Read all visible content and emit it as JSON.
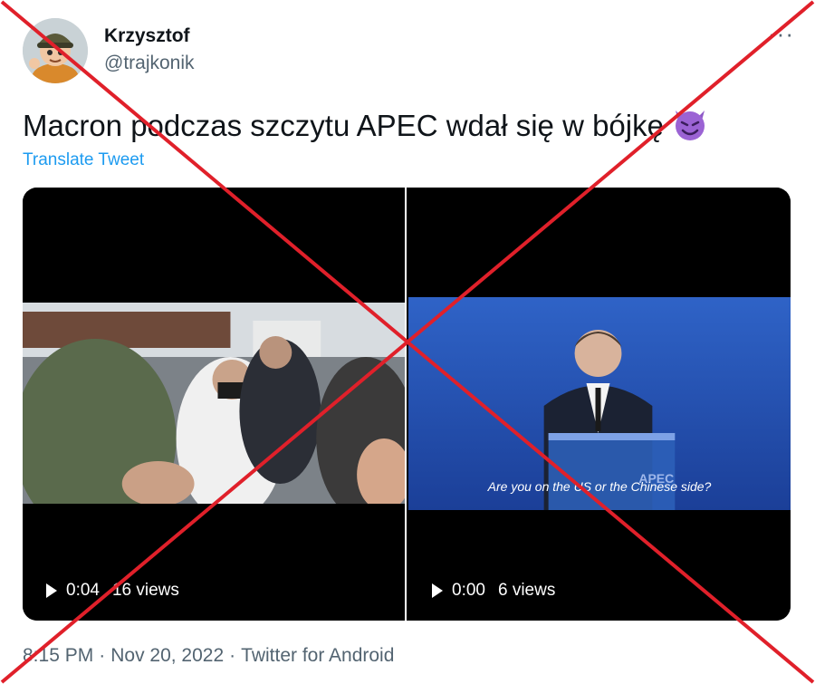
{
  "author": {
    "display_name": "Krzysztof",
    "handle": "@trajkonik",
    "avatar_icon": "cartoon-avatar"
  },
  "more_icon": "more-options-icon",
  "tweet": {
    "text": "Macron podczas szczytu APEC wdał się w bójkę",
    "emoji": "smiling-face-with-horns",
    "translate_label": "Translate Tweet"
  },
  "videos": [
    {
      "duration": "0:04",
      "views": "16 views",
      "subtitle": ""
    },
    {
      "duration": "0:00",
      "views": "6 views",
      "subtitle": "Are you on the US or the Chinese side?",
      "logo_text": "APEC"
    }
  ],
  "meta": {
    "time": "8:15 PM",
    "date": "Nov 20, 2022",
    "source": "Twitter for Android",
    "separator": "·"
  },
  "overlay": {
    "type": "red-cross",
    "color": "#e0202a"
  },
  "colors": {
    "accent": "#1d9bf0",
    "secondary_text": "#536471",
    "primary_text": "#0f1419"
  }
}
